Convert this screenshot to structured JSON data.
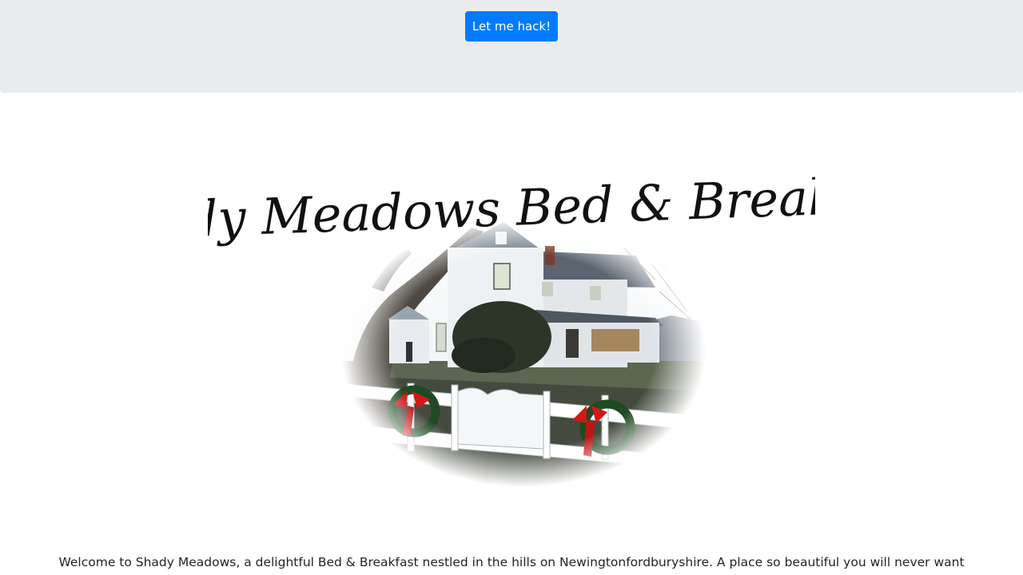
{
  "header": {
    "hack_button_label": "Let me hack!"
  },
  "logo": {
    "title_text": "Shady Meadows Bed & Breakfast",
    "image": "bed-and-breakfast-house-photo",
    "colors": {
      "title_ink": "#111111",
      "wreath_green": "#1f4a22",
      "bow_red": "#d01818",
      "house_white": "#eef1f4",
      "roof_slate": "#5b6470"
    }
  },
  "main": {
    "welcome_text": "Welcome to Shady Meadows, a delightful Bed & Breakfast nestled in the hills on Newingtonfordburyshire. A place so beautiful you will never want"
  },
  "colors": {
    "header_bg": "#e9ecef",
    "button_bg": "#007bff",
    "button_text": "#ffffff",
    "body_text": "#212529"
  }
}
